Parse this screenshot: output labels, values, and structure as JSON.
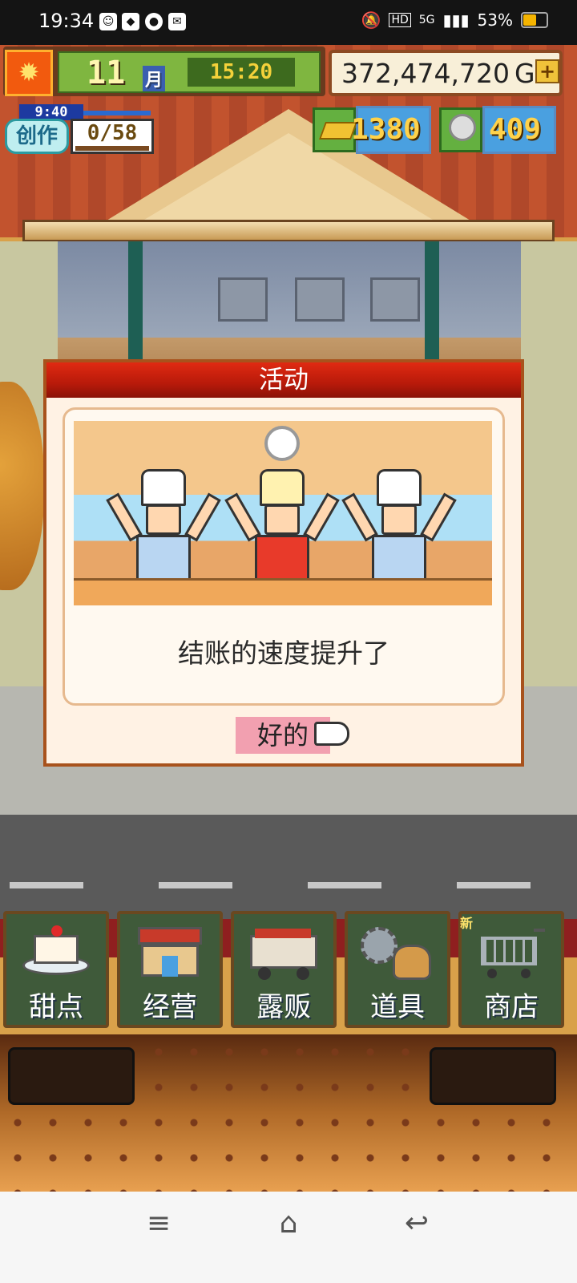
{
  "status_bar": {
    "time": "19:34",
    "signal": "5G",
    "battery": "53%",
    "battery_level": 0.53
  },
  "hud": {
    "month_number": "11",
    "month_unit": "月",
    "clock": "15:20",
    "gold": "372,474,720",
    "gold_unit": "G",
    "gold_plus": "+",
    "create_timer": "9:40",
    "create_label": "创作",
    "create_count": "0/58",
    "gold_bars": "1380",
    "silver_coins": "409"
  },
  "dialog": {
    "title": "活动",
    "message": "结账的速度提升了",
    "ok_button": "好的"
  },
  "menu": {
    "new_tag": "新",
    "items": [
      {
        "label": "甜点",
        "icon": "cake-icon"
      },
      {
        "label": "经营",
        "icon": "shop-building-icon"
      },
      {
        "label": "露贩",
        "icon": "food-truck-icon"
      },
      {
        "label": "道具",
        "icon": "gear-bag-icon"
      },
      {
        "label": "商店",
        "icon": "shopping-cart-icon"
      }
    ]
  },
  "navbar": {
    "menu": "≡",
    "home": "⌂",
    "back": "↩"
  },
  "colors": {
    "dialog_header": "#c41e0c",
    "ok_highlight": "#f2a0b0",
    "menu_green": "#3f5a3a"
  }
}
